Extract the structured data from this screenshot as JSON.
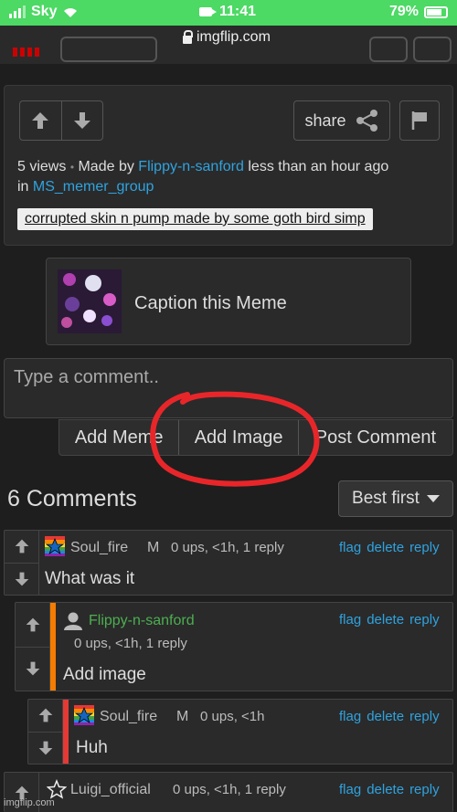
{
  "status": {
    "carrier": "Sky",
    "time": "11:41",
    "battery": "79%",
    "battery_level": 0.79
  },
  "browser": {
    "url": "imgflip.com"
  },
  "image_info": {
    "views_text": "5 views",
    "made_by_prefix": "Made by",
    "author": "Flippy-n-sanford",
    "time_ago": "less than an hour ago",
    "in_prefix": "in",
    "group": "MS_memer_group",
    "share_label": "share",
    "tag": "corrupted skin n pump made by some goth bird simp"
  },
  "caption": {
    "label": "Caption this Meme"
  },
  "comment_box": {
    "placeholder": "Type a comment..",
    "add_meme": "Add Meme",
    "add_image": "Add Image",
    "post_comment": "Post Comment"
  },
  "comments_header": {
    "title": "6 Comments",
    "sort": "Best first"
  },
  "comments": [
    {
      "user": "Soul_fire",
      "badge": "M",
      "meta": "0 ups, <1h, 1 reply",
      "text": "What was it"
    },
    {
      "user": "Flippy-n-sanford",
      "badge": "",
      "meta": "0 ups, <1h, 1 reply",
      "text": "Add image"
    },
    {
      "user": "Soul_fire",
      "badge": "M",
      "meta": "0 ups, <1h",
      "text": "Huh"
    },
    {
      "user": "Luigi_official",
      "badge": "",
      "meta": "0 ups, <1h, 1 reply",
      "text": ""
    }
  ],
  "comment_actions": {
    "flag": "flag",
    "delete": "delete",
    "reply": "reply"
  },
  "colors": {
    "status_green": "#4cd964",
    "link_blue": "#2fa3df",
    "stripe_orange": "#f57c00",
    "stripe_red": "#e53935",
    "annotation_red": "#e8262a"
  },
  "watermark": "imgflip.com"
}
